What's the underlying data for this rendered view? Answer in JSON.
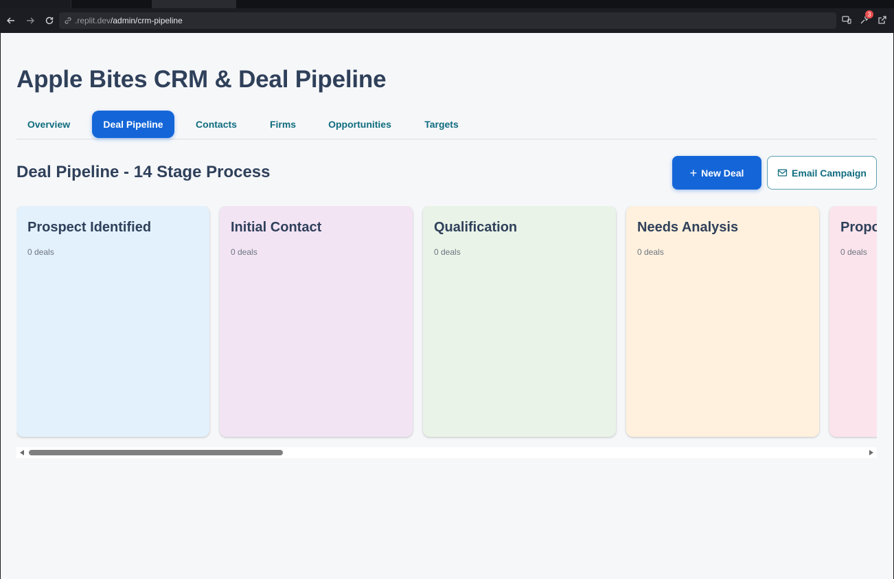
{
  "browser": {
    "url_prefix": ".replit.dev",
    "url_path": "/admin/crm-pipeline",
    "extensions_badge": "3"
  },
  "page": {
    "title": "Apple Bites CRM & Deal Pipeline",
    "tabs": [
      {
        "label": "Overview",
        "active": false
      },
      {
        "label": "Deal Pipeline",
        "active": true
      },
      {
        "label": "Contacts",
        "active": false
      },
      {
        "label": "Firms",
        "active": false
      },
      {
        "label": "Opportunities",
        "active": false
      },
      {
        "label": "Targets",
        "active": false
      }
    ],
    "section_title": "Deal Pipeline - 14 Stage Process",
    "new_deal_label": "New Deal",
    "email_campaign_label": "Email Campaign",
    "stages": [
      {
        "name": "Prospect Identified",
        "count": "0 deals",
        "color": "#e3f1fc"
      },
      {
        "name": "Initial Contact",
        "count": "0 deals",
        "color": "#f3e4f4"
      },
      {
        "name": "Qualification",
        "count": "0 deals",
        "color": "#e9f3e7"
      },
      {
        "name": "Needs Analysis",
        "count": "0 deals",
        "color": "#fff1dd"
      },
      {
        "name": "Proposal",
        "count": "0 deals",
        "color": "#fce4ec"
      }
    ]
  },
  "colors": {
    "accent": "#1466d8",
    "teal_text": "#0f6c7e",
    "heading": "#2f405a"
  }
}
